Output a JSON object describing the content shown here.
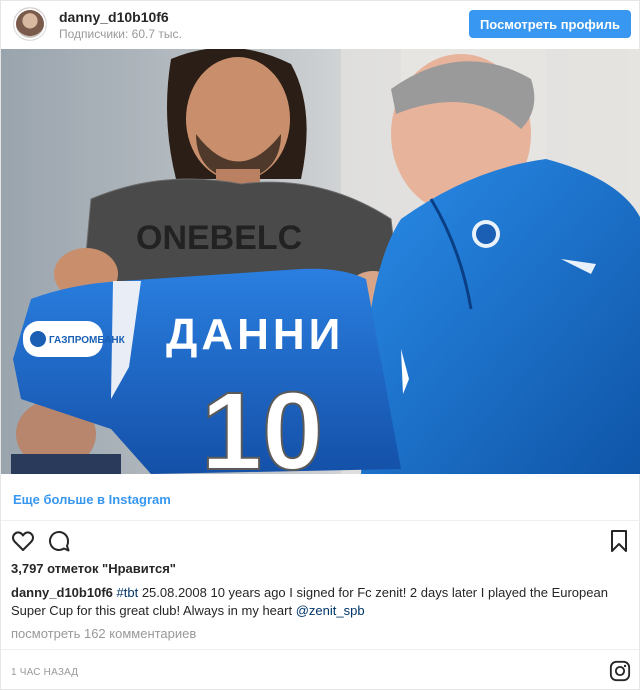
{
  "header": {
    "username": "danny_d10b10f6",
    "followers": "Подписчики: 60.7 тыс.",
    "view_profile": "Посмотреть профиль"
  },
  "photo": {
    "jersey_name": "ДАННИ",
    "jersey_number": "10",
    "sponsor": "ГАЗПРОМБАНК",
    "shirt_text": "ONEBELC"
  },
  "more_link": "Еще больше в Instagram",
  "actions": {
    "like_icon": "heart-icon",
    "comment_icon": "comment-icon",
    "save_icon": "bookmark-icon"
  },
  "likes": "3,797 отметок \"Нравится\"",
  "caption": {
    "username": "danny_d10b10f6",
    "hashtag": "#tbt",
    "text": "25.08.2008 10 years ago I signed for Fc zenit! 2 days later I played the European Super Cup for this great club! Always in my heart",
    "mention": "@zenit_spb"
  },
  "comments_link": "посмотреть 162 комментариев",
  "time": "1 ЧАС НАЗАД",
  "colors": {
    "accent": "#3897f0",
    "link": "#003569",
    "muted": "#999999",
    "jersey": "#1f6fd1"
  }
}
